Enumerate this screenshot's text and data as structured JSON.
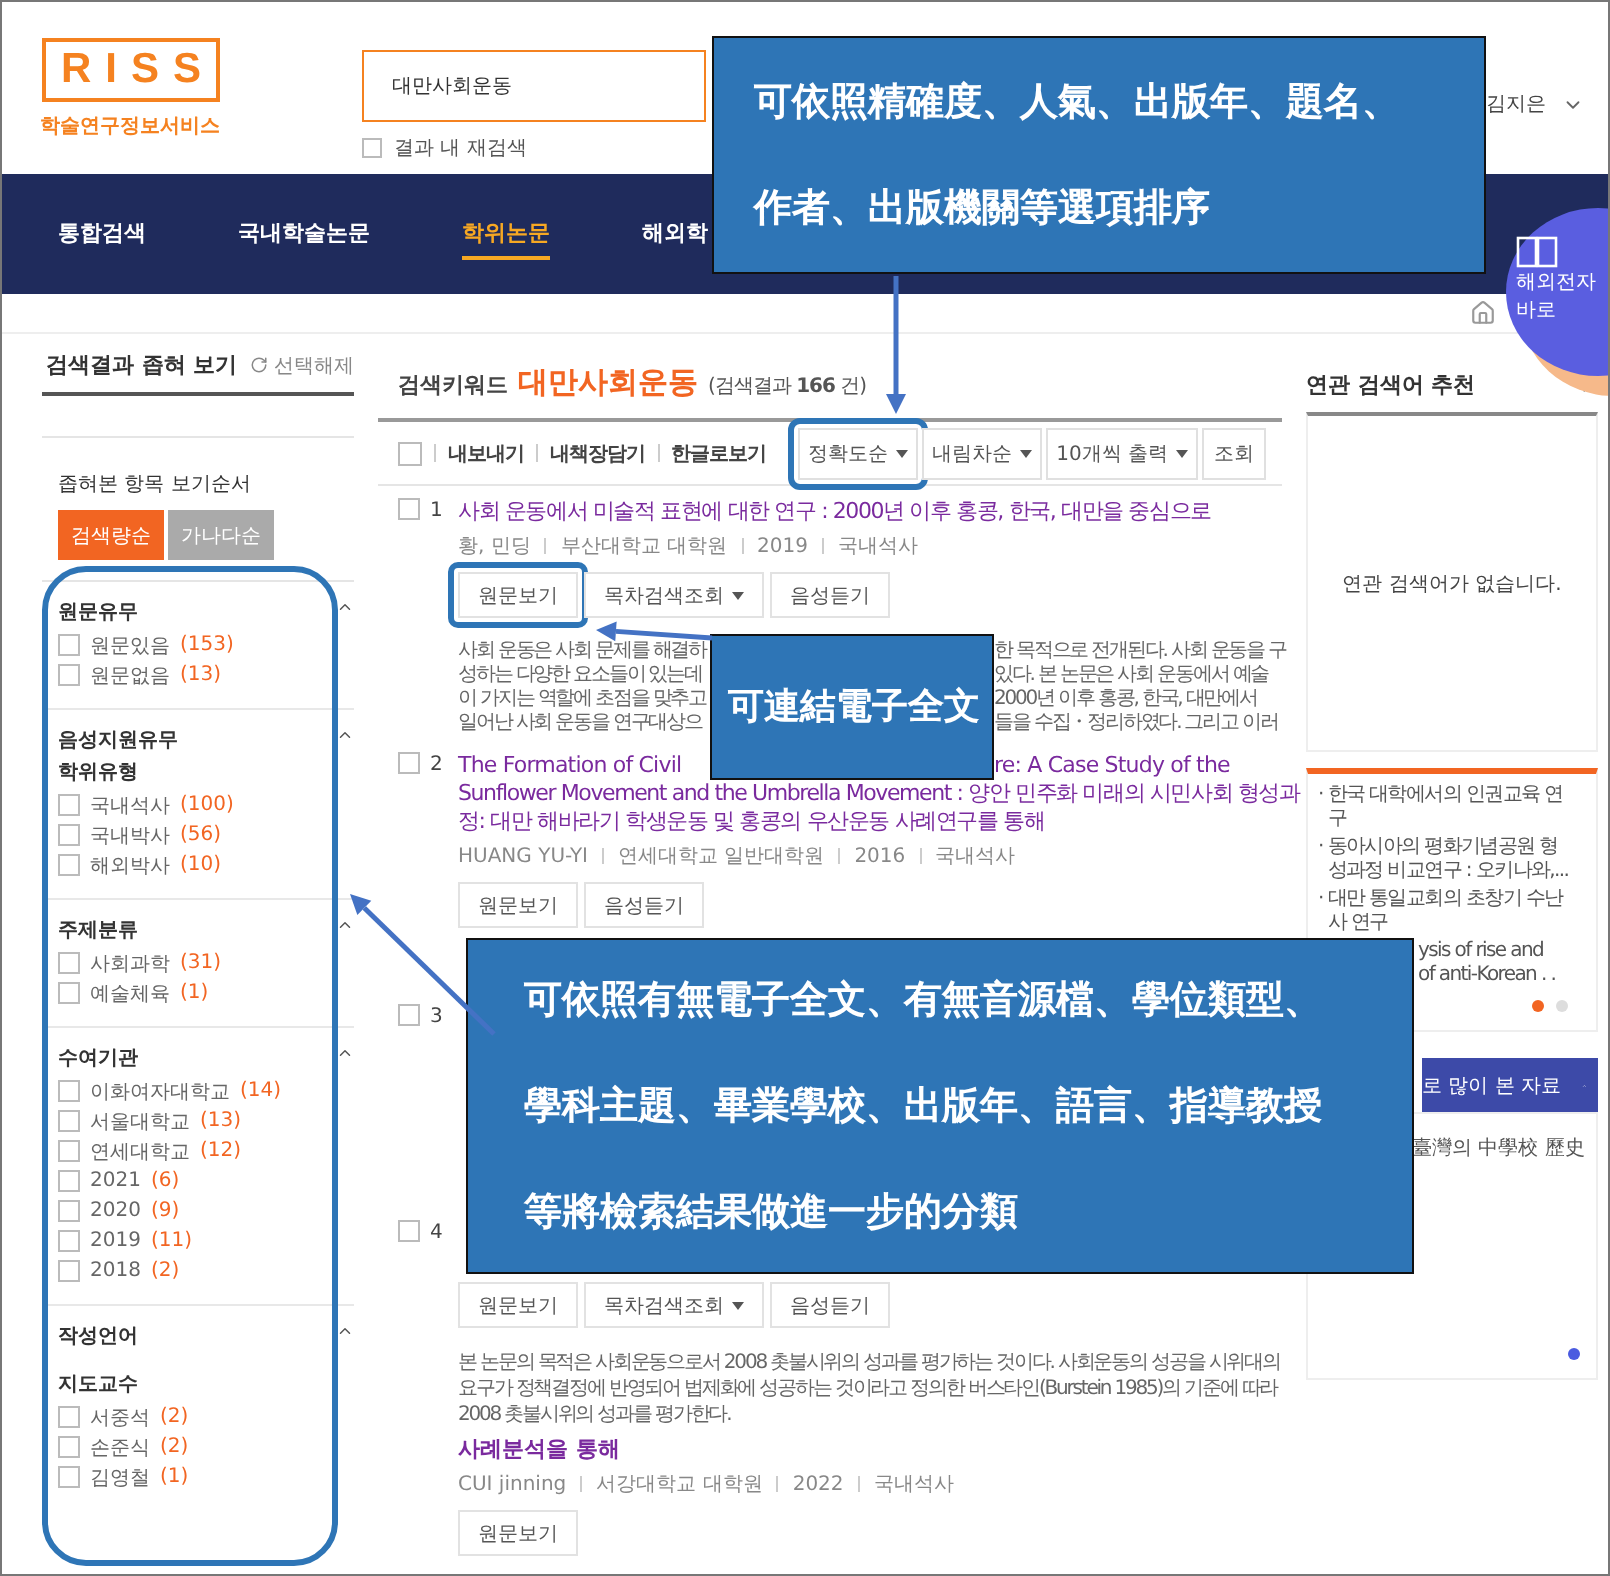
{
  "header": {
    "logo": "RISS",
    "logo_subtitle": "학술연구정보서비스",
    "search_value": "대만사회운동",
    "search_in_results": {
      "label": "결과 내 재검색",
      "checked": false
    },
    "user": "김지은"
  },
  "nav": [
    {
      "label": "통합검색",
      "selected": false
    },
    {
      "label": "국내학술논문",
      "selected": false
    },
    {
      "label": "학위논문",
      "selected": true
    },
    {
      "label": "해외학",
      "selected": false
    }
  ],
  "banner": {
    "lines": [
      "해외전자",
      "바로"
    ]
  },
  "sidebar": {
    "title": "검색결과 좁혀 보기",
    "reset": "선택해제",
    "order_label": "좁혀본 항목 보기순서",
    "order_buttons": [
      {
        "label": "검색량순",
        "selected": true
      },
      {
        "label": "가나다순",
        "selected": false
      }
    ],
    "groups": [
      {
        "titles": [
          "원문유무"
        ],
        "items": [
          {
            "label": "원문있음",
            "count": "(153)",
            "checked": false
          },
          {
            "label": "원문없음",
            "count": "(13)",
            "checked": false
          }
        ]
      },
      {
        "titles": [
          "음성지원유무",
          "학위유형"
        ],
        "items": [
          {
            "label": "국내석사",
            "count": "(100)",
            "checked": false
          },
          {
            "label": "국내박사",
            "count": "(56)",
            "checked": false
          },
          {
            "label": "해외박사",
            "count": "(10)",
            "checked": false
          }
        ]
      },
      {
        "titles": [
          "주제분류"
        ],
        "items": [
          {
            "label": "사회과학",
            "count": "(31)",
            "checked": false
          },
          {
            "label": "예술체육",
            "count": "(1)",
            "checked": false
          }
        ]
      },
      {
        "titles": [
          "수여기관"
        ],
        "items": [
          {
            "label": "이화여자대학교",
            "count": "(14)",
            "checked": false
          },
          {
            "label": "서울대학교",
            "count": "(13)",
            "checked": false
          },
          {
            "label": "연세대학교",
            "count": "(12)",
            "checked": false
          },
          {
            "label": "2021",
            "count": "(6)",
            "checked": false
          },
          {
            "label": "2020",
            "count": "(9)",
            "checked": false
          },
          {
            "label": "2019",
            "count": "(11)",
            "checked": false
          },
          {
            "label": "2018",
            "count": "(2)",
            "checked": false
          }
        ]
      },
      {
        "titles": [
          "작성언어",
          "지도교수"
        ],
        "items": [
          {
            "label": "서중석",
            "count": "(2)",
            "checked": false
          },
          {
            "label": "손준식",
            "count": "(2)",
            "checked": false
          },
          {
            "label": "김영철",
            "count": "(1)",
            "checked": false
          }
        ]
      }
    ]
  },
  "search": {
    "label": "검색키워드",
    "keyword": "대만사회운동",
    "count": "(검색결과 **166** 건)"
  },
  "toolbar": {
    "select_all": false,
    "actions": [
      "내보내기",
      "내책장담기",
      "한글로보기"
    ],
    "selects": [
      {
        "label": "정확도순",
        "highlighted": true
      },
      {
        "label": "내림차순",
        "highlighted": false
      },
      {
        "label": "10개씩 출력",
        "highlighted": false
      }
    ],
    "submit": "조회"
  },
  "results": [
    {
      "number": "1",
      "checked": false,
      "title_lines": [
        [
          "사회 운동에서 미술적 표현에 대한 연구 : 2000년 이후 홍콩, 한국, 대만을 중심으로"
        ]
      ],
      "meta": [
        "황, 민딩",
        "부산대학교 대학원",
        "2019",
        "국내석사"
      ],
      "buttons": [
        {
          "label": "원문보기",
          "dropdown": false,
          "highlighted": true
        },
        {
          "label": "목차검색조회",
          "dropdown": true,
          "highlighted": false
        },
        {
          "label": "음성듣기",
          "dropdown": false,
          "highlighted": false
        }
      ],
      "abstract_lines": [
        [
          "사회 운동은 사회 문제를 해결하",
          "한 목적으로 전개된다. 사회 운동을 구"
        ],
        [
          "성하는 다양한 요소들이 있는데",
          "있다. 본 논문은 사회 운동에서 예술"
        ],
        [
          "이 가지는 역할에 초점을 맞추고",
          "2000년 이후 홍콩, 한국, 대만에서"
        ],
        [
          "일어난 사회 운동을 연구대상으",
          "들을 수집・정리하였다. 그리고 이러"
        ]
      ]
    },
    {
      "number": "2",
      "checked": false,
      "title_lines": [
        [
          "The Formation of Civil",
          "re: A Case Study of the"
        ],
        [
          "Sunflower Movement and the Umbrella Movement : 양안 민주화 미래의 시민사회 형성과"
        ],
        [
          "정: 대만 해바라기 학생운동 및 홍콩의 우산운동 사례연구를 통해"
        ]
      ],
      "meta": [
        "HUANG YU-YI",
        "연세대학교 일반대학원",
        "2016",
        "국내석사"
      ],
      "buttons": [
        {
          "label": "원문보기",
          "dropdown": false,
          "highlighted": false
        },
        {
          "label": "음성듣기",
          "dropdown": false,
          "highlighted": false
        }
      ]
    },
    {
      "number": "3",
      "checked": false
    },
    {
      "number": "4",
      "checked": false,
      "buttons": [
        {
          "label": "원문보기",
          "dropdown": false,
          "highlighted": false
        },
        {
          "label": "목차검색조회",
          "dropdown": true,
          "highlighted": false
        },
        {
          "label": "음성듣기",
          "dropdown": false,
          "highlighted": false
        }
      ],
      "abstract_lines": [
        [
          "본 논문의 목적은 사회운동으로서 2008 촛불시위의 성과를 평가하는 것이다. 사회운동의 성공을 시위대의 요구가 정책결정에 반영되어 법제화에 성공하는 것이라고 정의한 버스타인(Burstein 1985)의 기준에 따라 2008 촛불시위의 성과를 평가한다."
        ]
      ],
      "title_tail": "사례분석을 통해",
      "meta": [
        "CUI jinning",
        "서강대학교 대학원",
        "2022",
        "국내석사"
      ],
      "more_buttons": [
        {
          "label": "원문보기"
        }
      ]
    }
  ],
  "related": {
    "title": "연관 검색어 추천",
    "empty": "연관 검색어가 없습니다."
  },
  "recommended": [
    {
      "lines": [
        "· 한국 대학에서의 인권교육 연",
        "구"
      ],
      "occluded": false
    },
    {
      "lines": [
        "· 동아시아의 평화기념공원 형",
        "성과정 비교연구 : 오키나와,..."
      ],
      "occluded": false
    },
    {
      "lines": [
        "· 대만 통일교회의 초창기 수난",
        "사 연구"
      ],
      "occluded": false
    },
    {
      "lines": [
        "ysis of rise and",
        "of anti-Korean . ."
      ],
      "occluded": true
    }
  ],
  "popular": {
    "title": "로 많이 본 자료",
    "items": [
      "臺灣의 中學校 歷史"
    ]
  },
  "callouts": [
    {
      "lines": [
        "可依照精確度、人氣、出版年、題名、",
        "作者、出版機關等選項排序"
      ]
    },
    {
      "lines": [
        "可連結電子全文"
      ]
    },
    {
      "lines": [
        "可依照有無電子全文、有無音源檔、學位類型、",
        "學科主題、畢業學校、出版年、語言、指導教授",
        "等將檢索結果做進一步的分類"
      ]
    }
  ]
}
